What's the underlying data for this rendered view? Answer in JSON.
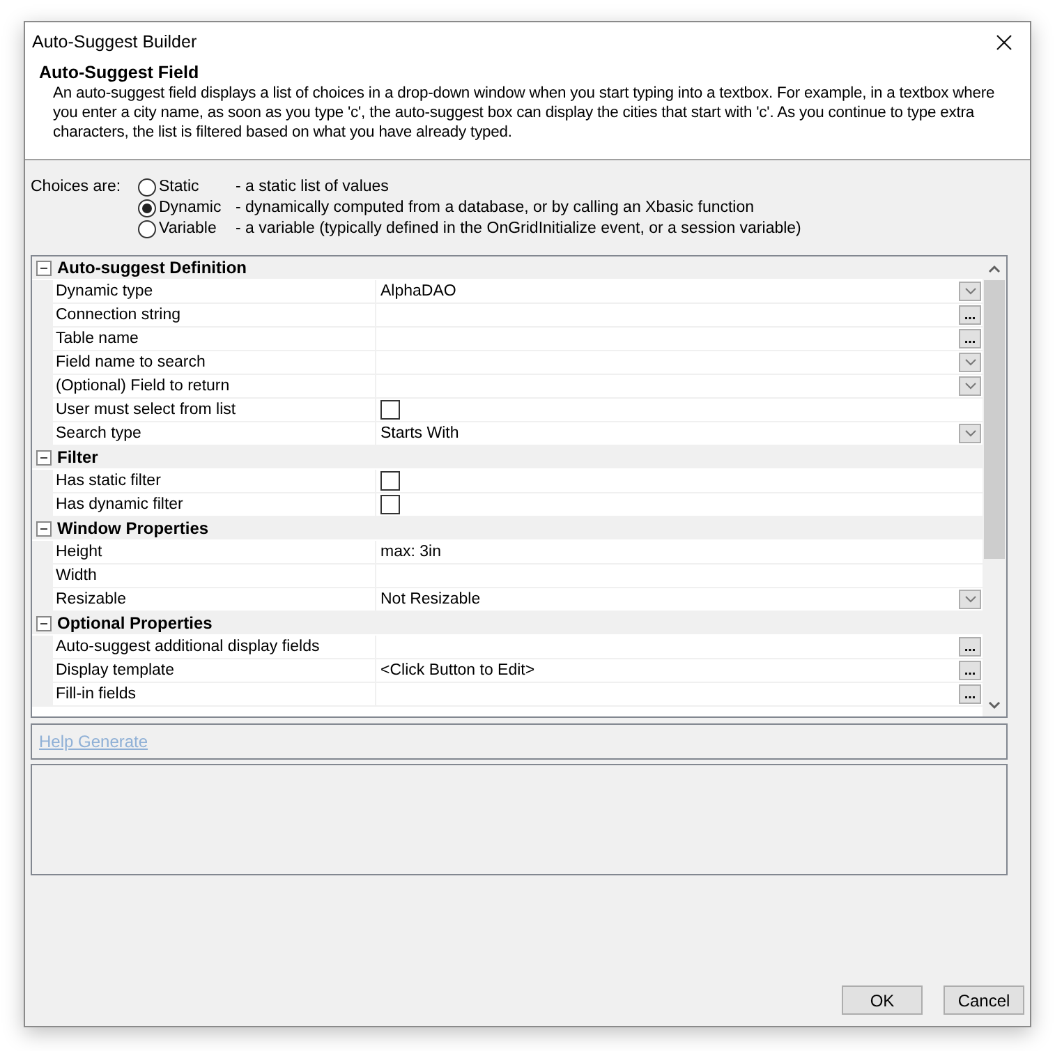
{
  "window": {
    "title": "Auto-Suggest Builder"
  },
  "header": {
    "title": "Auto-Suggest Field",
    "description": "An auto-suggest field displays a list of choices in a drop-down window when you start typing into a textbox. For example, in a textbox where you enter a city name, as soon as you type 'c', the auto-suggest box can display the cities that start with 'c'. As you continue to type extra characters, the list is filtered based on what you have already typed."
  },
  "choices": {
    "label": "Choices are:",
    "options": [
      {
        "label": "Static",
        "description": "- a static list of values",
        "selected": false
      },
      {
        "label": "Dynamic",
        "description": "- dynamically computed from a database, or by calling an Xbasic function",
        "selected": true
      },
      {
        "label": "Variable",
        "description": "- a variable (typically defined in the OnGridInitialize event, or a session variable)",
        "selected": false
      }
    ]
  },
  "properties": {
    "sections": [
      {
        "title": "Auto-suggest Definition",
        "expanded": true,
        "rows": [
          {
            "name": "Dynamic type",
            "kind": "dropdown",
            "value": "AlphaDAO"
          },
          {
            "name": "Connection string",
            "kind": "ellipsis",
            "button": "..."
          },
          {
            "name": "Table name",
            "kind": "ellipsis",
            "button": "..."
          },
          {
            "name": "Field name to search",
            "kind": "dropdown"
          },
          {
            "name": "(Optional) Field to return",
            "kind": "dropdown"
          },
          {
            "name": "User must select from list",
            "kind": "checkbox",
            "checked": false
          },
          {
            "name": "Search type",
            "kind": "dropdown",
            "value": "Starts With"
          }
        ]
      },
      {
        "title": "Filter",
        "expanded": true,
        "rows": [
          {
            "name": "Has static filter",
            "kind": "checkbox",
            "checked": false
          },
          {
            "name": "Has dynamic filter",
            "kind": "checkbox",
            "checked": false
          }
        ]
      },
      {
        "title": "Window Properties",
        "expanded": true,
        "rows": [
          {
            "name": "Height",
            "kind": "text",
            "value": "max: 3in"
          },
          {
            "name": "Width",
            "kind": "text"
          },
          {
            "name": "Resizable",
            "kind": "dropdown",
            "value": "Not Resizable"
          }
        ]
      },
      {
        "title": "Optional Properties",
        "expanded": true,
        "rows": [
          {
            "name": "Auto-suggest additional display fields",
            "kind": "ellipsis",
            "button": "..."
          },
          {
            "name": "Display template",
            "kind": "ellipsis",
            "value": "<Click Button to Edit>",
            "button": "..."
          },
          {
            "name": "Fill-in fields",
            "kind": "ellipsis",
            "button": "..."
          }
        ]
      }
    ]
  },
  "help_link": "Help Generate",
  "buttons": [
    {
      "label": "OK"
    },
    {
      "label": "Cancel"
    }
  ]
}
